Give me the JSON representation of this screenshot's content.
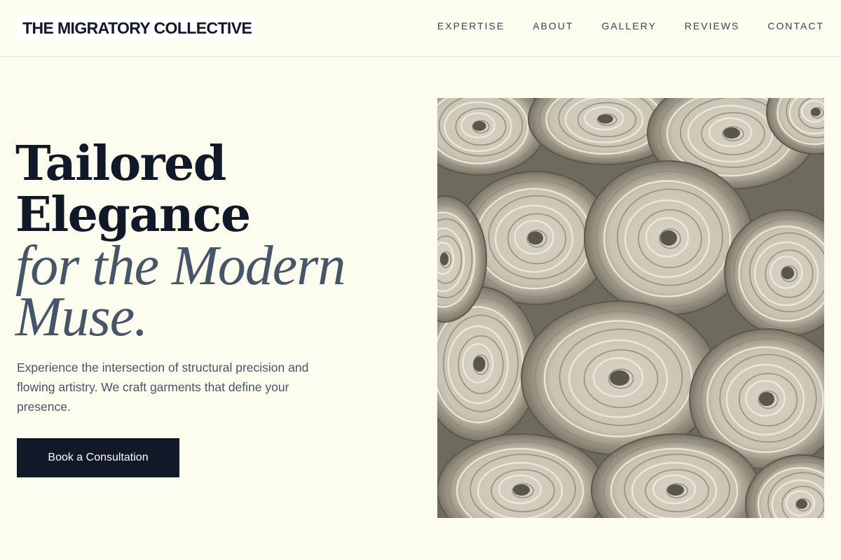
{
  "header": {
    "brand": "THE MIGRATORY COLLECTIVE",
    "nav": [
      {
        "label": "EXPERTISE"
      },
      {
        "label": "ABOUT"
      },
      {
        "label": "GALLERY"
      },
      {
        "label": "REVIEWS"
      },
      {
        "label": "CONTACT"
      }
    ]
  },
  "hero": {
    "title_line1": "Tailored",
    "title_line2": "Elegance",
    "title_italic_line1": "for the Modern",
    "title_italic_line2": "Muse.",
    "description": "Experience the intersection of structural precision and flowing artistry. We craft garments that define your presence.",
    "cta_label": "Book a Consultation",
    "image_subject": "rolled-fabric-bolts-photo"
  },
  "colors": {
    "background": "#fdfdef",
    "primary_dark": "#111827",
    "muted_text": "#475569"
  }
}
